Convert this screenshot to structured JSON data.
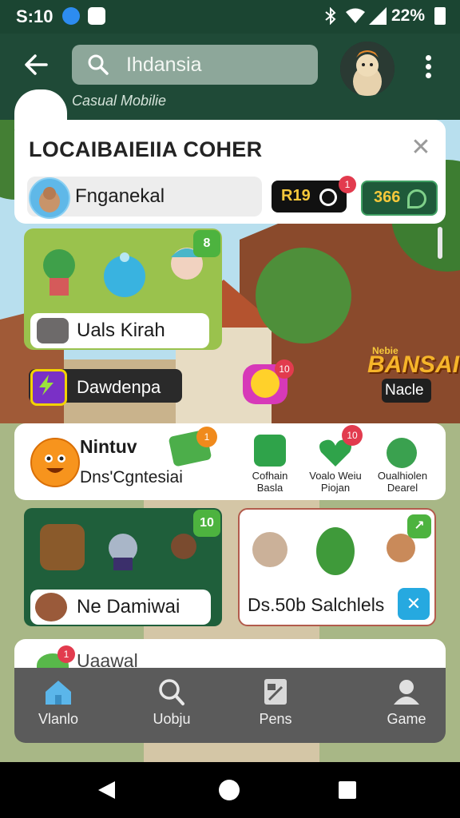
{
  "status_bar": {
    "time": "S:10",
    "battery": "22%"
  },
  "header": {
    "search_value": "Ihdansia",
    "subtitle": "Casual Mobilie"
  },
  "dialog": {
    "title": "LOCAIBAIEIIA COHER",
    "profile_name": "Fnganekal",
    "pill_dark_value": "R19",
    "pill_dark_badge": "1",
    "pill_green_value": "366"
  },
  "cards": {
    "green_card_corner": "8",
    "green_card_label": "Uals Kirah",
    "chip_label": "Dawdenpa",
    "smiley_badge": "10",
    "banner_text": "BANSAI!",
    "banner_small": "Nebie",
    "chip_small": "Nacle"
  },
  "promo": {
    "title": "Nintuv",
    "subtitle": "Dns'Cgntesiai",
    "money_badge": "1",
    "features": [
      {
        "label": "Cofhain\nBasla"
      },
      {
        "label": "Voalo Weiu\nPiojan",
        "badge": "10"
      },
      {
        "label": "Oualhiolen\nDearel"
      }
    ]
  },
  "lower": {
    "dark_card_corner": "10",
    "dark_card_label": "Ne Damiwai",
    "white_card_label": "Ds.50b Salchlels",
    "peek_badge": "1",
    "peek_text": "Uaawal"
  },
  "bottom_nav": [
    {
      "label": "Vlanlo",
      "icon": "home-icon"
    },
    {
      "label": "Uobju",
      "icon": "search-icon"
    },
    {
      "label": "Pens",
      "icon": "grid-icon"
    },
    {
      "label": "Game",
      "icon": "person-icon"
    }
  ],
  "colors": {
    "brand": "#1f4a37",
    "accent_green": "#4db33f",
    "badge_red": "#e23b4e"
  }
}
